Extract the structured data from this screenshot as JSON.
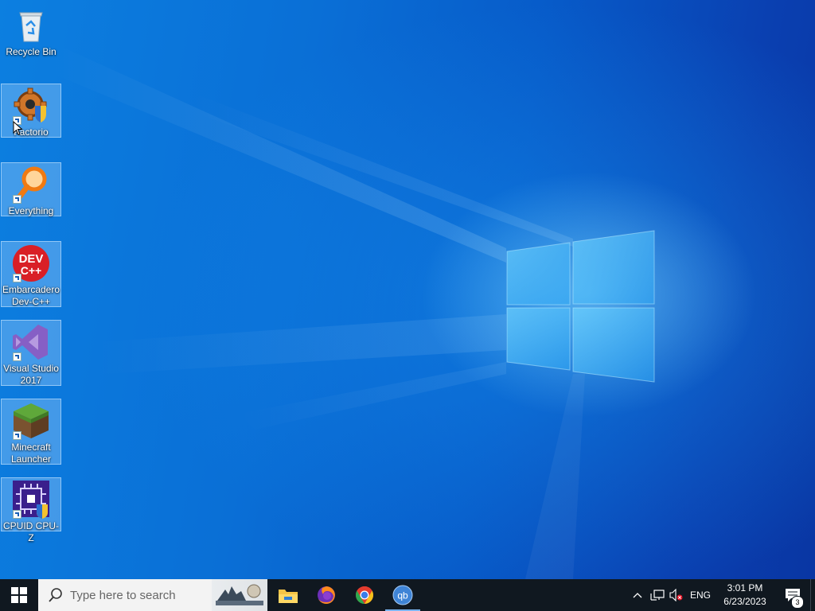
{
  "desktop": {
    "icons": [
      {
        "label": "Recycle Bin",
        "icon": "recycle-bin-icon",
        "shortcut": false,
        "selected": false
      },
      {
        "label": "Factorio",
        "icon": "factorio-icon",
        "shortcut": true,
        "selected": true
      },
      {
        "label": "Everything",
        "icon": "everything-search-icon",
        "shortcut": true,
        "selected": true
      },
      {
        "label": "Embarcadero Dev-C++",
        "icon": "devcpp-icon",
        "shortcut": true,
        "selected": true,
        "glyph_top": "DEV",
        "glyph_bottom": "C++"
      },
      {
        "label": "Visual Studio 2017",
        "icon": "visual-studio-icon",
        "shortcut": true,
        "selected": true
      },
      {
        "label": "Minecraft Launcher",
        "icon": "minecraft-icon",
        "shortcut": true,
        "selected": true
      },
      {
        "label": "CPUID CPU-Z",
        "icon": "cpuz-icon",
        "shortcut": true,
        "selected": true
      }
    ]
  },
  "taskbar": {
    "start_icon": "windows-start-icon",
    "search": {
      "placeholder": "Type here to search",
      "icon": "search-icon"
    },
    "news_icon": "news-weather-icon",
    "pinned": [
      {
        "name": "File Explorer",
        "icon": "file-explorer-icon",
        "running": false
      },
      {
        "name": "Firefox",
        "icon": "firefox-icon",
        "running": false
      },
      {
        "name": "Google Chrome",
        "icon": "chrome-icon",
        "running": false
      },
      {
        "name": "qBittorrent",
        "icon": "qbittorrent-icon",
        "running": true,
        "glyph": "qb"
      }
    ],
    "tray": {
      "chevron_icon": "chevron-up-icon",
      "network_icon": "network-icon",
      "volume_icon": "volume-muted-icon",
      "language": "ENG",
      "time": "3:01 PM",
      "date": "6/23/2023",
      "notification_icon": "notification-icon",
      "notification_count": "3"
    }
  },
  "colors": {
    "desktop_accent": "#0a6fd6",
    "taskbar_bg": "#101820",
    "search_bg": "#f3f3f3"
  }
}
